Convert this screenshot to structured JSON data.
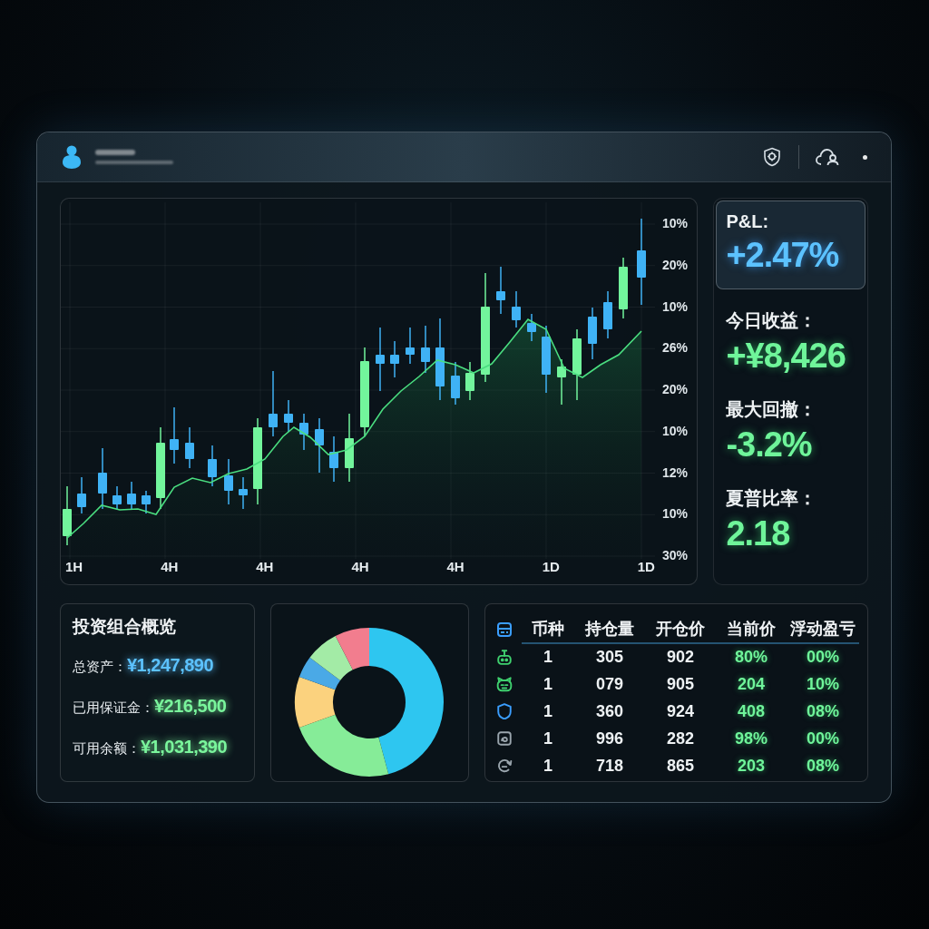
{
  "chart": {
    "y_axis_labels": [
      "10%",
      "20%",
      "10%",
      "26%",
      "20%",
      "10%",
      "12%",
      "10%",
      "30%"
    ],
    "x_axis_labels": [
      "1H",
      "4H",
      "4H",
      "4H",
      "4H",
      "1D",
      "1D"
    ]
  },
  "stats": [
    {
      "label": "P&L:",
      "value": "+2.47%",
      "highlighted": true
    },
    {
      "label": "今日收益：",
      "value": "+¥8,426",
      "highlighted": false
    },
    {
      "label": "最大回撤：",
      "value": "-3.2%",
      "highlighted": false
    },
    {
      "label": "夏普比率：",
      "value": "2.18",
      "highlighted": false
    }
  ],
  "portfolio": {
    "title": "投资组合概览",
    "rows": [
      {
        "label": "总资产：",
        "value": "¥1,247,890",
        "color": "#5cc2ff"
      },
      {
        "label": "已用保证金：",
        "value": "¥216,500",
        "color": "#7af59c"
      },
      {
        "label": "可用余额：",
        "value": "¥1,031,390",
        "color": "#7af59c"
      }
    ]
  },
  "positions_table": {
    "columns": [
      "币种",
      "持仓量",
      "开仓价",
      "当前价",
      "浮动盈亏"
    ],
    "rows": [
      {
        "color": "#3fd16f",
        "cells": [
          "1",
          "305",
          "902",
          "80%",
          "00%"
        ]
      },
      {
        "color": "#3fd16f",
        "cells": [
          "1",
          "079",
          "905",
          "204",
          "10%"
        ]
      },
      {
        "color": "#3b9eff",
        "cells": [
          "1",
          "360",
          "924",
          "408",
          "08%"
        ]
      },
      {
        "color": "#9aa5ad",
        "cells": [
          "1",
          "996",
          "282",
          "98%",
          "00%"
        ]
      },
      {
        "color": "#9aa5ad",
        "cells": [
          "1",
          "718",
          "865",
          "203",
          "08%"
        ]
      }
    ]
  }
}
